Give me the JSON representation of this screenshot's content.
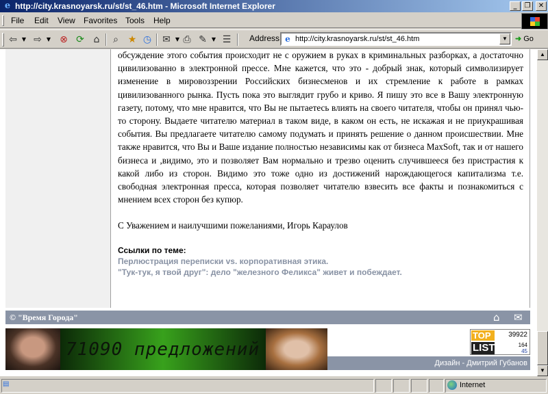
{
  "window": {
    "title": "http://city.krasnoyarsk.ru/st/st_46.htm - Microsoft Internet Explorer",
    "minimize_glyph": "_",
    "maximize_glyph": "❐",
    "close_glyph": "✕"
  },
  "menu": {
    "items": [
      "File",
      "Edit",
      "View",
      "Favorites",
      "Tools",
      "Help"
    ]
  },
  "toolbar": {
    "address_label": "Address",
    "url": "http://city.krasnoyarsk.ru/st/st_46.htm",
    "go_label": "Go",
    "icons": [
      "back-icon",
      "forward-icon",
      "stop-icon",
      "refresh-icon",
      "home-icon",
      "search-icon",
      "favorites-icon",
      "history-icon",
      "mail-icon",
      "print-icon",
      "edit-icon",
      "discuss-icon"
    ]
  },
  "article": {
    "body": "обсуждение этого события происходит не с оружием в руках в криминальных разборках, а достаточно цивилизованно в электронной прессе. Мне кажется, что это - добрый знак, который символизирует изменение в мировоззрении Российских бизнесменов и их стремление к работе в рамках цивилизованного рынка. Пусть пока это выглядит грубо и криво. Я пишу это все в Вашу электронную газету, потому, что мне нравится, что Вы не пытаетесь влиять на своего читателя, чтобы он принял чью-то сторону. Выдаете читателю материал в таком виде, в каком он есть, не искажая и не приукрашивая события. Вы предлагаете читателю самому подумать и принять решение о данном происшествии. Мне также нравится, что Вы и Ваше издание полностью независимы как от бизнеса MaxSoft, так и от нашего бизнеса и ,видимо, это и позволяет Вам нормально и трезво оценить случившееся без пристрастия к какой либо из сторон. Видимо это тоже одно из достижений нарождающегося капитализма т.е. свободная электронная пресса, которая позволяет читателю взвесить все факты и познакомиться с мнением всех сторон без купюр.",
    "signature": "С Уважением и наилучшими пожеланиями, Игорь Караулов",
    "links_title": "Ссылки по теме:",
    "links": [
      "Перлюстрация переписки vs. корпоративная этика.",
      "\"Тук-тук, я твой друг\": дело \"железного Феликса\" живет и побеждает."
    ]
  },
  "footer": {
    "copyright": "© \"Время Города\"",
    "home_icon": "home-icon",
    "mail_icon": "mail-icon",
    "banner_text": "71090 предложений",
    "counter": {
      "top_label": "TOP",
      "list_label": "LIST",
      "total": "39922",
      "stat1": "164",
      "stat2": "45"
    },
    "design_credit": "Дизайн - Дмитрий Губанов"
  },
  "status": {
    "zone": "Internet"
  },
  "colors": {
    "footer_bar": "#8a94a6",
    "link": "#8892a4",
    "left_column": "#f0f0f0"
  }
}
